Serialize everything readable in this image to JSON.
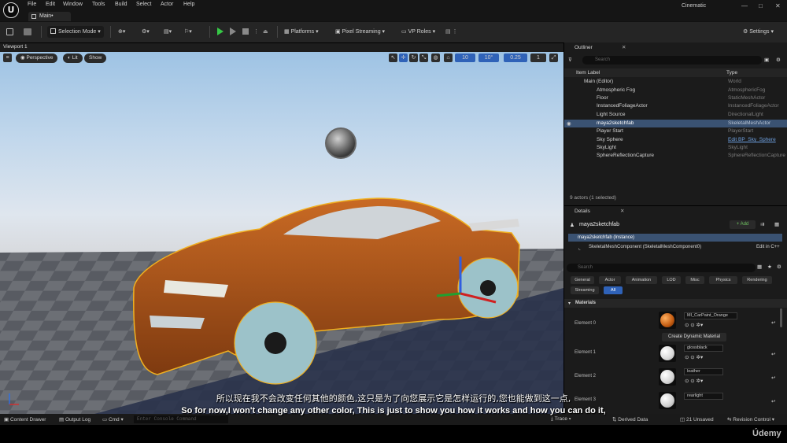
{
  "menu": [
    "File",
    "Edit",
    "Window",
    "Tools",
    "Build",
    "Select",
    "Actor",
    "Help"
  ],
  "level_tab": "Main•",
  "layout_mode": "Cinematic",
  "window_controls": {
    "min": "—",
    "max": "□",
    "close": "✕"
  },
  "toolbar": {
    "selection_mode": "Selection Mode",
    "platforms": "Platforms",
    "pixel_streaming": "Pixel Streaming",
    "vp_roles": "VP Roles",
    "settings": "Settings"
  },
  "viewport": {
    "tab": "Viewport 1",
    "perspective": "Perspective",
    "lit": "Lit",
    "show": "Show",
    "grid_snap": "10",
    "rot_snap": "10°",
    "scale_snap": "0.25",
    "cam_speed": "1"
  },
  "outliner": {
    "tab": "Outliner",
    "search_placeholder": "Search",
    "col_label": "Item Label",
    "col_type": "Type",
    "items": [
      {
        "label": "Main (Editor)",
        "type": "World"
      },
      {
        "label": "Atmospheric Fog",
        "type": "AtmosphericFog"
      },
      {
        "label": "Floor",
        "type": "StaticMeshActor"
      },
      {
        "label": "InstancedFoliageActor",
        "type": "InstancedFoliageActor"
      },
      {
        "label": "Light Source",
        "type": "DirectionalLight"
      },
      {
        "label": "maya2sketchfab",
        "type": "SkeletalMeshActor"
      },
      {
        "label": "Player Start",
        "type": "PlayerStart"
      },
      {
        "label": "Sky Sphere",
        "type": "Edit BP_Sky_Sphere"
      },
      {
        "label": "SkyLight",
        "type": "SkyLight"
      },
      {
        "label": "SphereReflectionCapture",
        "type": "SphereReflectionCapture"
      }
    ],
    "status": "9 actors (1 selected)"
  },
  "details": {
    "tab": "Details",
    "actor_name": "maya2sketchfab",
    "add_button": "+ Add",
    "instance": "maya2sketchfab (Instance)",
    "component": "SkeletalMeshComponent (SkeletalMeshComponent0)",
    "edit_cpp": "Edit in C++",
    "search_placeholder": "Search",
    "categories": [
      "General",
      "Actor",
      "Animation",
      "LOD",
      "Misc",
      "Physics",
      "Rendering",
      "Streaming",
      "All"
    ],
    "section": "Materials",
    "elements": [
      {
        "label": "Element 0",
        "material": "MI_CarPaint_Orange",
        "color": "#d56a12"
      },
      {
        "label": "Element 1",
        "material": "glossblack",
        "color": "#e8e8e8"
      },
      {
        "label": "Element 2",
        "material": "leather",
        "color": "#e4e4e4"
      },
      {
        "label": "Element 3",
        "material": "rearlight",
        "color": "#e2e2e2"
      }
    ],
    "create_dynamic": "Create Dynamic Material"
  },
  "bottom": {
    "content_drawer": "Content Drawer",
    "output_log": "Output Log",
    "cmd": "Cmd",
    "console_placeholder": "Enter Console Command",
    "trace": "Trace",
    "derived_data": "Derived Data",
    "unsaved": "21 Unsaved",
    "revision": "Revision Control"
  },
  "subtitles": {
    "cn": "所以现在我不会改变任何其他的颜色,这只是为了向您展示它是怎样运行的,您也能做到这一点,",
    "en": "So for now,I won't change any other color, This is just to show you how it works and how you can do it,"
  },
  "watermark": "Údemy",
  "colors": {
    "accent": "#3a5272",
    "car": "#b85a1a",
    "play": "#36c846"
  }
}
